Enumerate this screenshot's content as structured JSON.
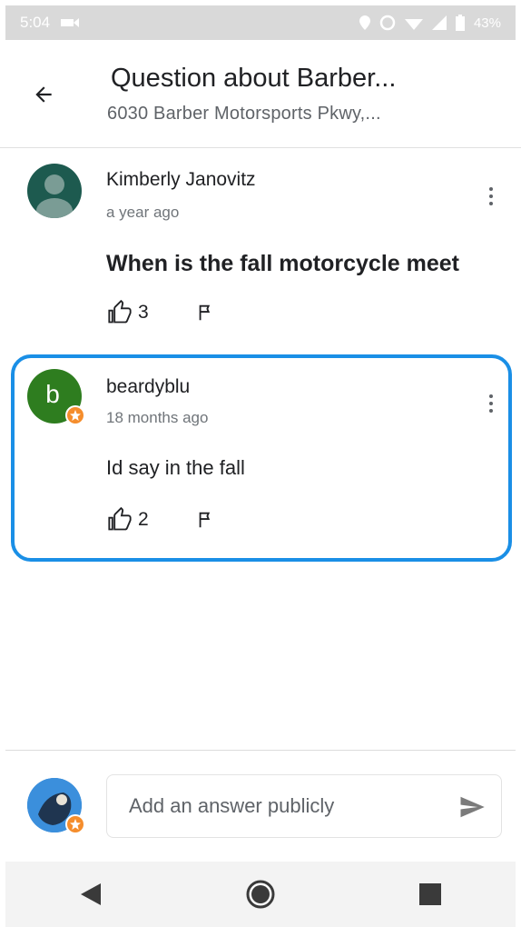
{
  "status_bar": {
    "time": "5:04",
    "battery": "43%"
  },
  "header": {
    "title": "Question about Barber...",
    "subtitle": "6030 Barber Motorsports Pkwy,..."
  },
  "question": {
    "author": "Kimberly Janovitz",
    "time": "a year ago",
    "text": "When is the fall motorcycle meet",
    "likes": "3",
    "avatar_color": "#1d5a4f"
  },
  "answer": {
    "author": "beardyblu",
    "avatar_letter": "b",
    "time": "18 months ago",
    "text": "Id say in the fall",
    "likes": "2",
    "avatar_color": "#2e7d1f"
  },
  "compose": {
    "placeholder": "Add an answer publicly"
  },
  "icons": {
    "back": "arrow-left-icon",
    "menu": "more-vert-icon",
    "like": "thumb-up-icon",
    "flag": "flag-icon",
    "send": "send-icon",
    "nav_back": "triangle-back-icon",
    "nav_home": "circle-home-icon",
    "nav_recent": "square-recent-icon"
  },
  "colors": {
    "highlight": "#1a8fe6",
    "badge": "#f58d2c"
  }
}
